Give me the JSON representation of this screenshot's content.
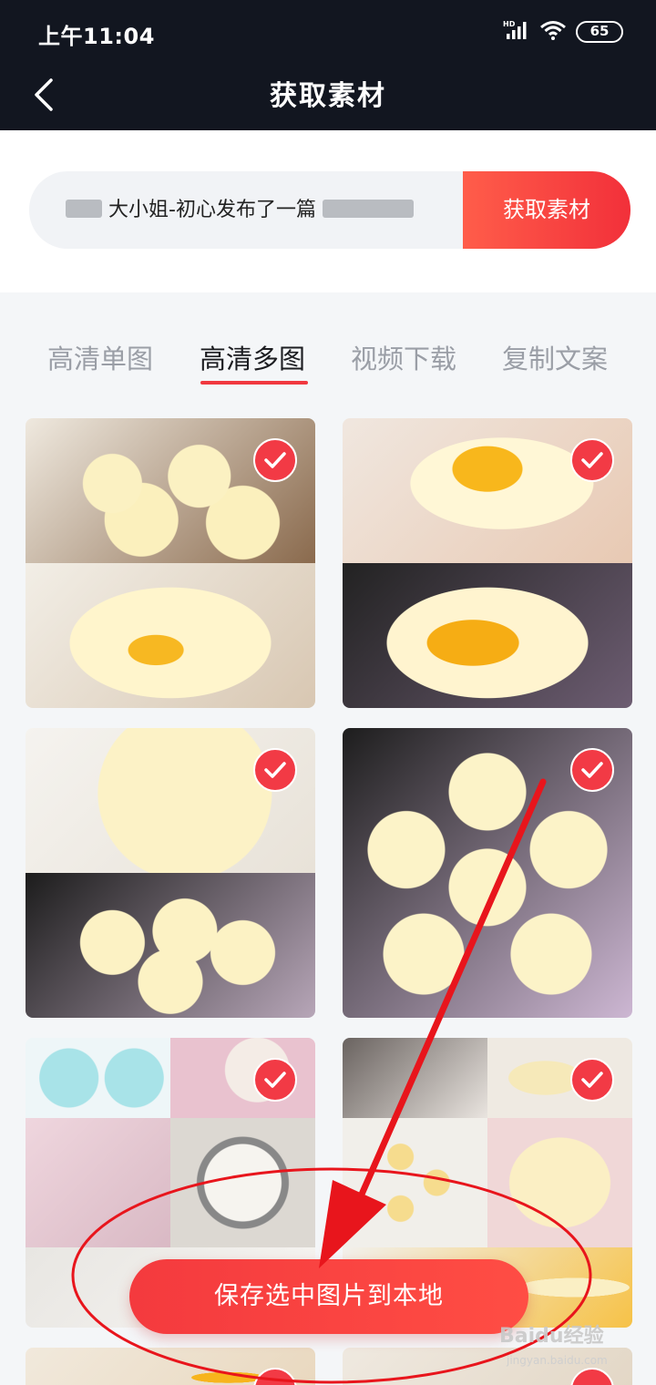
{
  "status_bar": {
    "time": "上午11:04",
    "battery": "65",
    "network": "HD"
  },
  "nav": {
    "title": "获取素材",
    "back_icon": "chevron-left-icon"
  },
  "url_input": {
    "value_visible": "大小姐-初心发布了一篇",
    "button_label": "获取素材"
  },
  "tabs": [
    {
      "label": "高清单图",
      "active": false
    },
    {
      "label": "高清多图",
      "active": true
    },
    {
      "label": "视频下载",
      "active": false
    },
    {
      "label": "复制文案",
      "active": false
    }
  ],
  "images": [
    {
      "selected": true,
      "subject": "steamed buns with mango filling"
    },
    {
      "selected": true,
      "subject": "bun cut open with mango filling"
    },
    {
      "selected": true,
      "subject": "single steamed bun and buns in paper cups"
    },
    {
      "selected": true,
      "subject": "five steamed buns in paper cups"
    },
    {
      "selected": true,
      "subject": "preparation steps collage"
    },
    {
      "selected": true,
      "subject": "dough preparation collage"
    },
    {
      "selected": true,
      "subject": "partially visible image"
    },
    {
      "selected": true,
      "subject": "partially visible image"
    }
  ],
  "save_button": {
    "label": "保存选中图片到本地"
  },
  "watermark": {
    "brand": "Baidu经验",
    "url": "jingyan.baidu.com"
  },
  "colors": {
    "accent": "#f0383f",
    "header_bg": "#121620",
    "page_bg": "#f4f6f8",
    "annotation": "#e8151c"
  }
}
